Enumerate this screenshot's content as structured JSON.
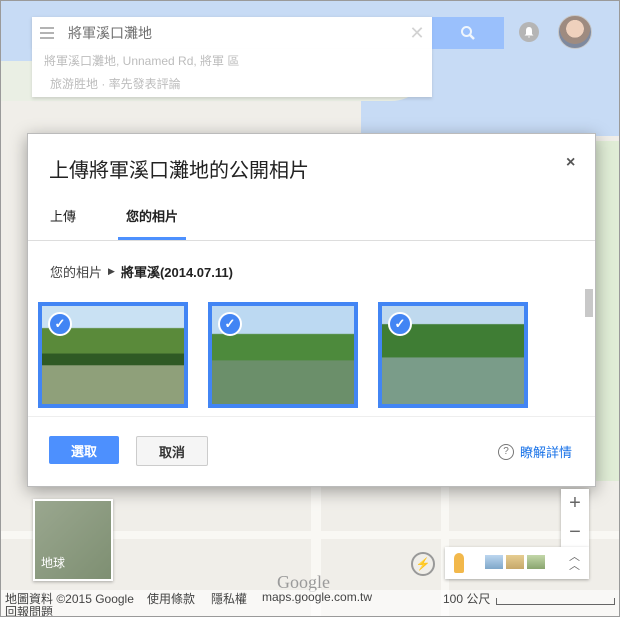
{
  "search": {
    "query": "將軍溪口灘地",
    "suggestion_line1": "將軍溪口灘地, Unnamed Rd, 將軍 區",
    "suggestion_line2": "旅游胜地 · 率先發表評論"
  },
  "dialog": {
    "title": "上傳將軍溪口灘地的公開相片",
    "close": "×",
    "tabs": [
      {
        "label": "上傳",
        "active": false
      },
      {
        "label": "您的相片",
        "active": true
      }
    ],
    "breadcrumb_root": "您的相片",
    "breadcrumb_album": "將軍溪(2014.07.11)",
    "photos": [
      {
        "selected": true
      },
      {
        "selected": true
      },
      {
        "selected": true
      }
    ],
    "check_glyph": "✓",
    "select_label": "選取",
    "cancel_label": "取消",
    "learn_more": "瞭解詳情",
    "help_glyph": "?"
  },
  "map": {
    "earth_label": "地球",
    "zoom_in": "+",
    "zoom_out": "−",
    "google_logo": "Google",
    "footer": {
      "data": "地圖資料 ©2015 Google",
      "terms": "使用條款",
      "privacy": "隱私權",
      "site": "maps.google.com.tw",
      "scale": "100 公尺",
      "report": "回報問題"
    }
  },
  "colors": {
    "accent": "#4d90fe",
    "photo_border": "#4285f4",
    "water": "#a9c8f0"
  },
  "icons": [
    "menu-icon",
    "clear-icon",
    "search-icon",
    "notifications-icon",
    "avatar",
    "close-icon",
    "chevron-right-icon",
    "check-icon",
    "help-icon",
    "pegman-icon",
    "expand-icon",
    "flash-icon"
  ]
}
